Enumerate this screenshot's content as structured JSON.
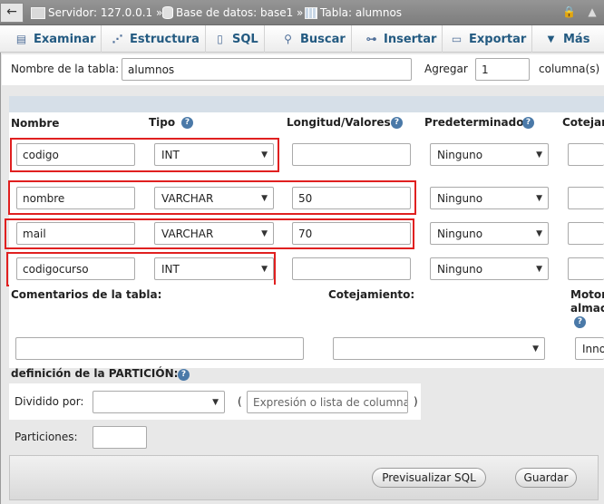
{
  "topbar": {
    "back_label": "←",
    "server": "Servidor: 127.0.0.1 »",
    "database": "Base de datos: base1 »",
    "table": "Tabla: alumnos"
  },
  "tabs": [
    {
      "label": "Examinar",
      "icon": "browse-icon"
    },
    {
      "label": "Estructura",
      "icon": "structure-icon"
    },
    {
      "label": "SQL",
      "icon": "sql-icon"
    },
    {
      "label": "Buscar",
      "icon": "search-icon"
    },
    {
      "label": "Insertar",
      "icon": "insert-icon"
    },
    {
      "label": "Exportar",
      "icon": "export-icon"
    },
    {
      "label": "Más",
      "icon": "caret-down-icon"
    }
  ],
  "table_name_row": {
    "label": "Nombre de la tabla:",
    "value": "alumnos",
    "add_label": "Agregar",
    "add_count": "1",
    "columns_label": "columna(s)"
  },
  "headers": {
    "name": "Nombre",
    "type": "Tipo",
    "length": "Longitud/Valores",
    "default": "Predeterminado",
    "collation": "Cotejam"
  },
  "columns": [
    {
      "name": "codigo",
      "type": "INT",
      "length": "",
      "default": "Ninguno"
    },
    {
      "name": "nombre",
      "type": "VARCHAR",
      "length": "50",
      "default": "Ninguno"
    },
    {
      "name": "mail",
      "type": "VARCHAR",
      "length": "70",
      "default": "Ninguno"
    },
    {
      "name": "codigocurso",
      "type": "INT",
      "length": "",
      "default": "Ninguno"
    }
  ],
  "table_options": {
    "comments_label": "Comentarios de la tabla:",
    "collation_label": "Cotejamiento:",
    "engine_label_1": "Motor",
    "engine_label_2": "almac",
    "engine_value": "Inno"
  },
  "partition": {
    "title": "definición de la PARTICIÓN:",
    "divided_label": "Dividido por:",
    "paren_open": "(",
    "expr_placeholder": "Expresión o lista de columna",
    "paren_close": ")",
    "partitions_label": "Particiones:"
  },
  "footer": {
    "preview_label": "Previsualizar SQL",
    "save_label": "Guardar"
  },
  "colors": {
    "accent_link": "#235a81",
    "highlight": "#e02020",
    "topbar": "#8a8a8a"
  }
}
